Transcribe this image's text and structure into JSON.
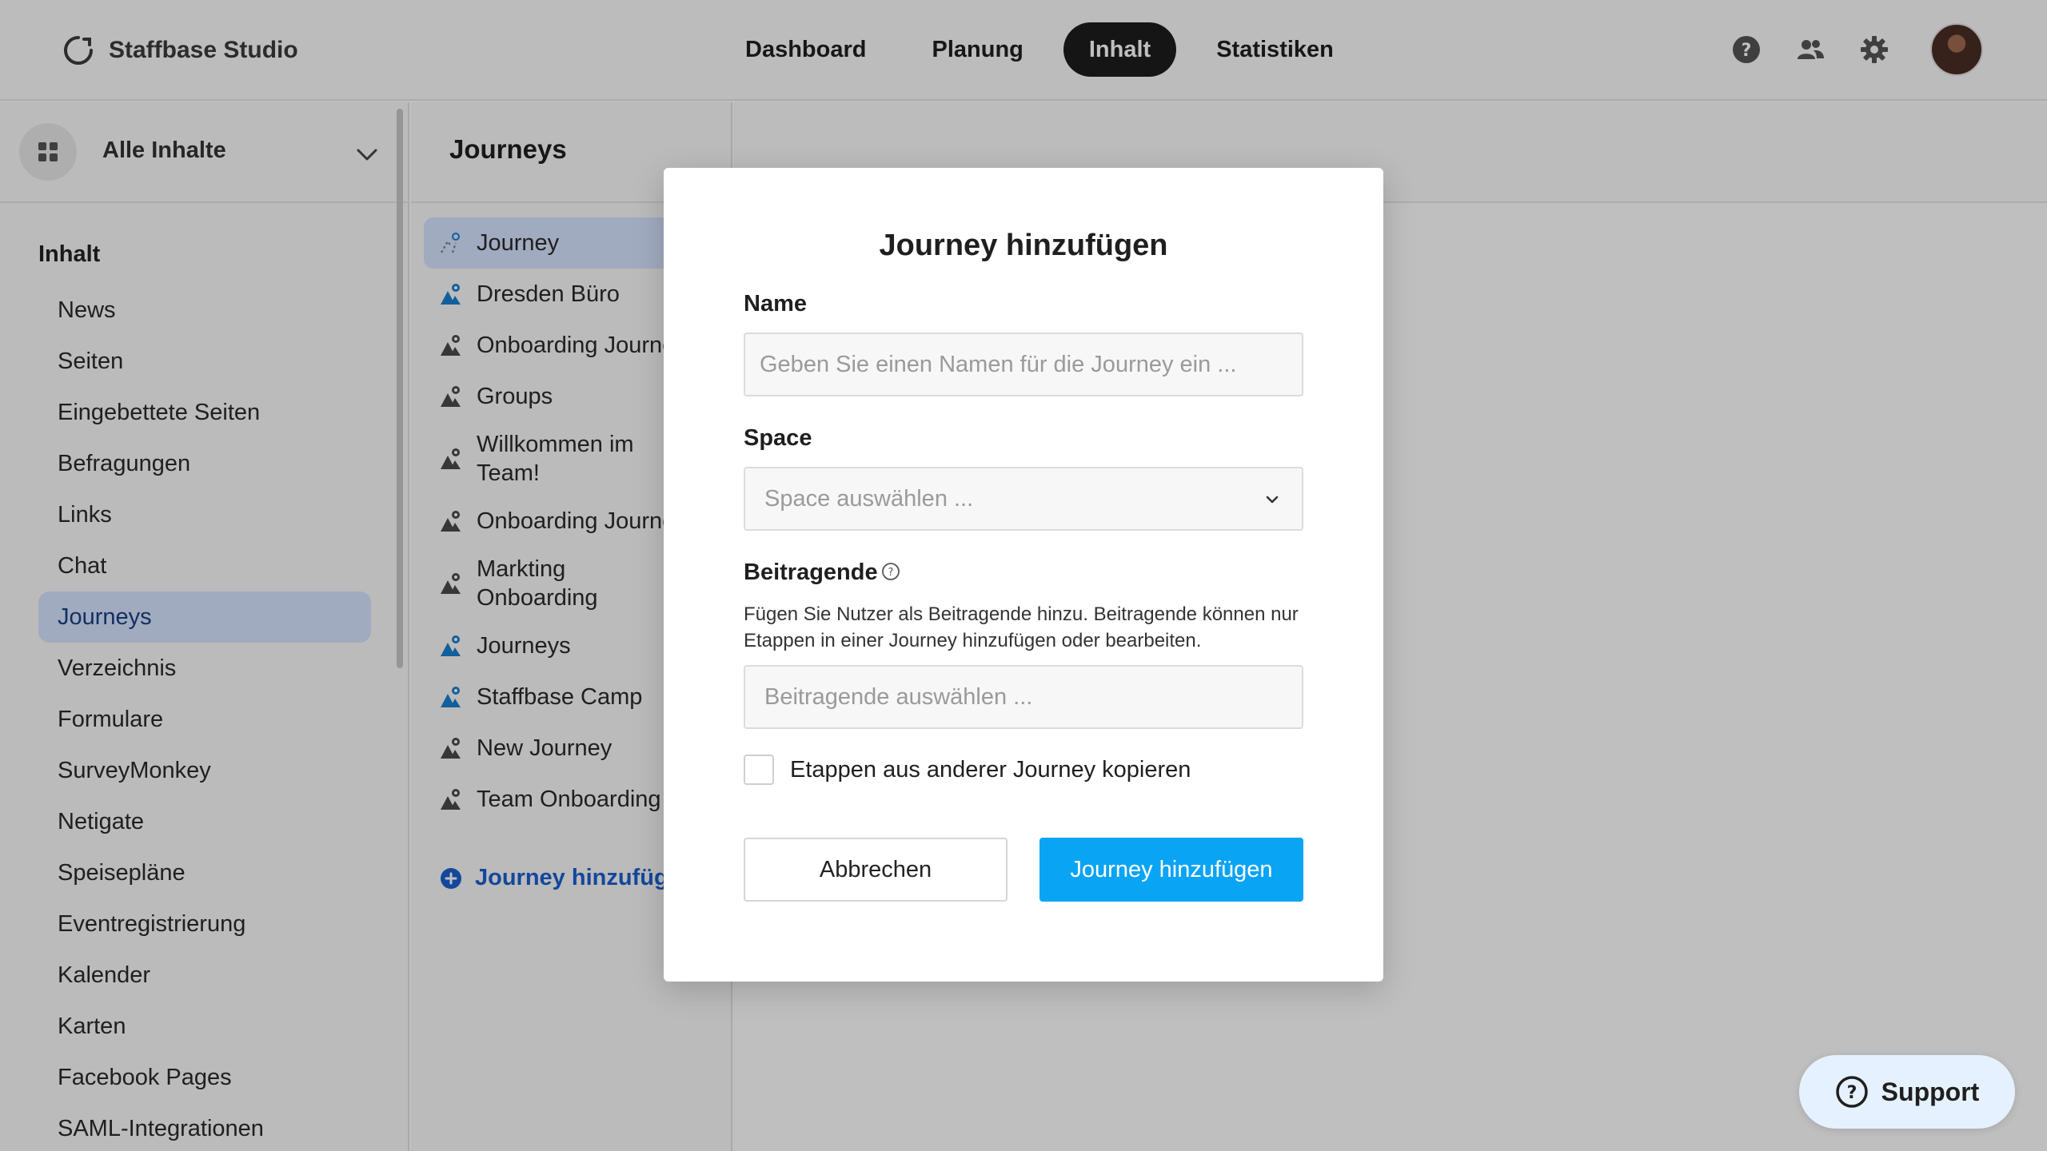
{
  "header": {
    "brand": "Staffbase Studio",
    "nav": [
      {
        "label": "Dashboard"
      },
      {
        "label": "Planung"
      },
      {
        "label": "Inhalt"
      },
      {
        "label": "Statistiken"
      }
    ],
    "active_nav": "Inhalt",
    "icons": [
      "help-icon",
      "users-icon",
      "gear-icon",
      "avatar"
    ]
  },
  "sidebar": {
    "scope_label": "Alle Inhalte",
    "section_title": "Inhalt",
    "items": [
      {
        "label": "News"
      },
      {
        "label": "Seiten"
      },
      {
        "label": "Eingebettete Seiten"
      },
      {
        "label": "Befragungen"
      },
      {
        "label": "Links"
      },
      {
        "label": "Chat"
      },
      {
        "label": "Journeys"
      },
      {
        "label": "Verzeichnis"
      },
      {
        "label": "Formulare"
      },
      {
        "label": "SurveyMonkey"
      },
      {
        "label": "Netigate"
      },
      {
        "label": "Speisepläne"
      },
      {
        "label": "Eventregistrierung"
      },
      {
        "label": "Kalender"
      },
      {
        "label": "Karten"
      },
      {
        "label": "Facebook Pages"
      },
      {
        "label": "SAML-Integrationen"
      }
    ],
    "active_item": "Journeys"
  },
  "journeys": {
    "title": "Journeys",
    "items": [
      {
        "label": "Journey"
      },
      {
        "label": "Dresden Büro"
      },
      {
        "label": "Onboarding Journey"
      },
      {
        "label": "Groups"
      },
      {
        "label": "Willkommen im Team!"
      },
      {
        "label": "Onboarding Journey"
      },
      {
        "label": "Markting Onboarding"
      },
      {
        "label": "Journeys"
      },
      {
        "label": "Staffbase Camp"
      },
      {
        "label": "New Journey"
      },
      {
        "label": "Team Onboarding"
      }
    ],
    "add_label": "Journey hinzufügen"
  },
  "modal": {
    "title": "Journey hinzufügen",
    "name_label": "Name",
    "name_placeholder": "Geben Sie einen Namen für die Journey ein ...",
    "name_value": "",
    "space_label": "Space",
    "space_placeholder": "Space auswählen ...",
    "contributors_label": "Beitragende",
    "contributors_hint": "Fügen Sie Nutzer als Beitragende hinzu. Beitragende können nur Etappen in einer Journey hinzufügen oder bearbeiten.",
    "contributors_placeholder": "Beitragende auswählen ...",
    "copy_checkbox_label": "Etappen aus anderer Journey kopieren",
    "copy_checked": false,
    "cancel_label": "Abbrechen",
    "submit_label": "Journey hinzufügen"
  },
  "support": {
    "label": "Support"
  },
  "colors": {
    "primary": "#0aa4f5",
    "active_nav_bg": "#1c1c1c",
    "active_item_bg": "#d7e4ff",
    "link": "#1b5fd1",
    "journey_icon_blue": "#1a7fd1",
    "journey_icon_dark": "#4a4a4a"
  }
}
